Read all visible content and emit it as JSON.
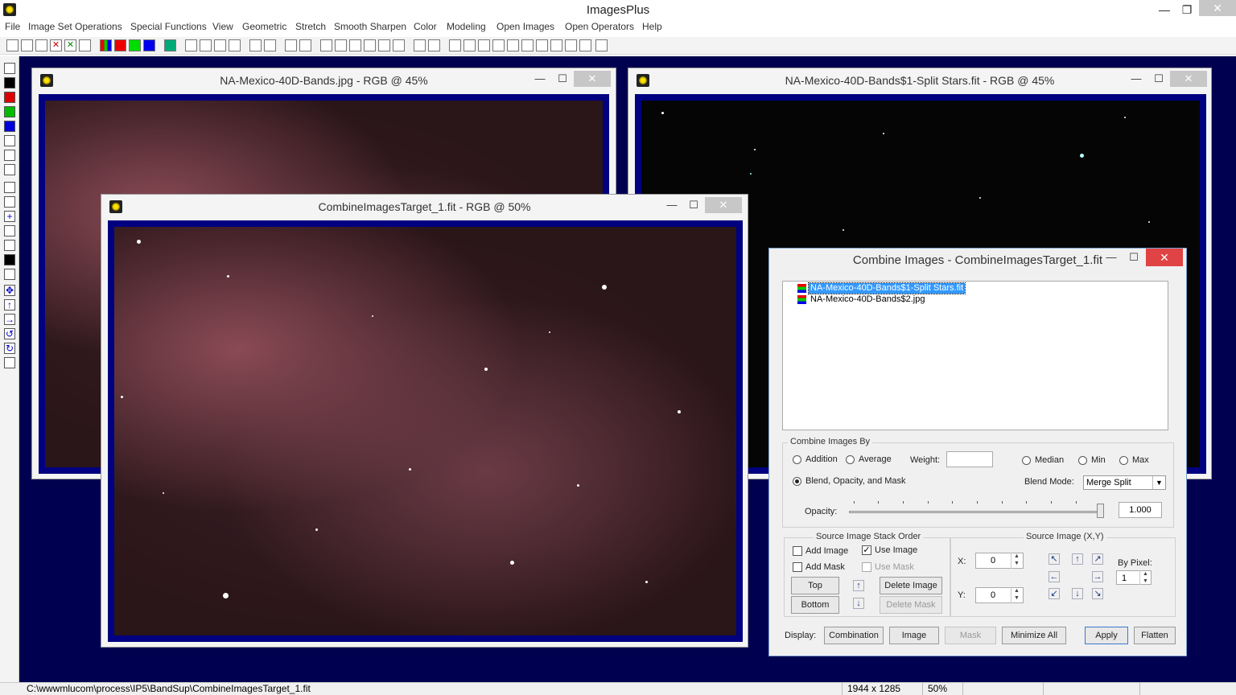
{
  "app": {
    "title": "ImagesPlus"
  },
  "menu": [
    "File",
    "Image Set Operations",
    "Special Functions",
    "View",
    "Geometric",
    "Stretch",
    "Smooth Sharpen",
    "Color",
    "Modeling",
    "Open Images",
    "Open Operators",
    "Help"
  ],
  "windows": {
    "w1": {
      "title": "NA-Mexico-40D-Bands.jpg - RGB @ 45%"
    },
    "w2": {
      "title": "NA-Mexico-40D-Bands$1-Split Stars.fit - RGB @ 45%"
    },
    "w3": {
      "title": "CombineImagesTarget_1.fit - RGB @ 50%"
    }
  },
  "dialog": {
    "title": "Combine Images - CombineImagesTarget_1.fit",
    "list": [
      "NA-Mexico-40D-Bands$1-Split Stars.fit",
      "NA-Mexico-40D-Bands$2.jpg"
    ],
    "combine_by": {
      "label": "Combine Images By",
      "addition": "Addition",
      "average": "Average",
      "weight": "Weight:",
      "median": "Median",
      "min": "Min",
      "max": "Max",
      "blend": "Blend, Opacity, and Mask",
      "blend_mode_label": "Blend Mode:",
      "blend_mode_value": "Merge Split",
      "opacity_label": "Opacity:",
      "opacity_value": "1.000"
    },
    "stack": {
      "label": "Source Image Stack Order",
      "add_image": "Add Image",
      "use_image": "Use Image",
      "add_mask": "Add Mask",
      "use_mask": "Use Mask",
      "top": "Top",
      "bottom": "Bottom",
      "delete_image": "Delete Image",
      "delete_mask": "Delete Mask"
    },
    "source": {
      "label": "Source Image (X,Y)",
      "x_label": "X:",
      "x_value": "0",
      "y_label": "Y:",
      "y_value": "0",
      "by_pixel": "By Pixel:",
      "by_pixel_value": "1"
    },
    "display": {
      "label": "Display:",
      "combination": "Combination",
      "image": "Image",
      "mask": "Mask",
      "minimize_all": "Minimize All",
      "apply": "Apply",
      "flatten": "Flatten"
    }
  },
  "status": {
    "path": "C:\\wwwmlucom\\process\\IP5\\BandSup\\CombineImagesTarget_1.fit",
    "dims": "1944 x 1285",
    "zoom": "50%"
  }
}
